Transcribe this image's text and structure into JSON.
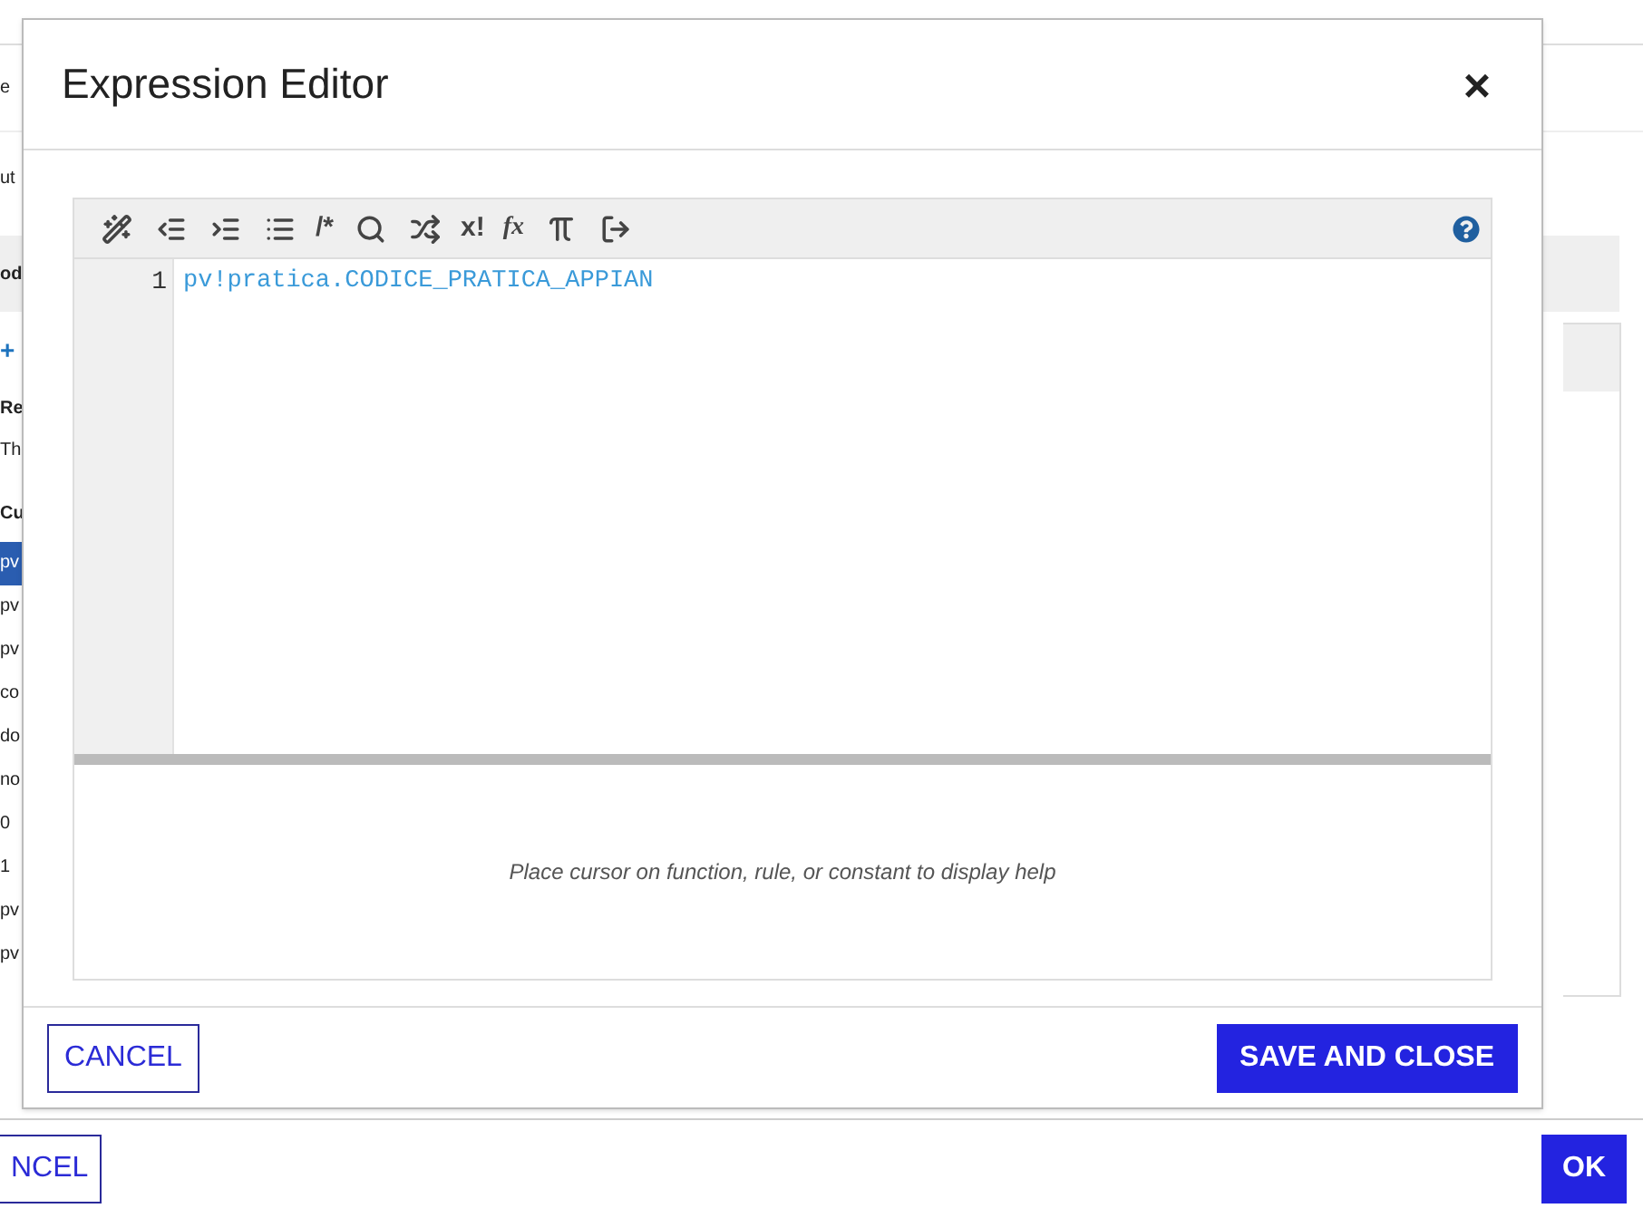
{
  "background": {
    "line_1": "e",
    "line_2": "ut",
    "panel_header": "od",
    "add": "+",
    "section_1": {
      "title": "Re",
      "text": "Th"
    },
    "section_2": {
      "title": "Cu",
      "items": [
        {
          "label": "pv",
          "selected": true
        },
        {
          "label": "pv",
          "selected": false
        },
        {
          "label": "pv",
          "selected": false
        },
        {
          "label": "co",
          "selected": false
        },
        {
          "label": "do",
          "selected": false
        },
        {
          "label": "no",
          "selected": false
        },
        {
          "label": "0",
          "selected": false
        },
        {
          "label": "1",
          "selected": false
        },
        {
          "label": "pv",
          "selected": false
        },
        {
          "label": "pv",
          "selected": false
        }
      ]
    },
    "buttons": {
      "cancel": "NCEL",
      "ok": "OK"
    }
  },
  "dialog": {
    "title": "Expression Editor",
    "close": "×",
    "toolbar": [
      {
        "kind": "icon"
      },
      {
        "kind": "icon"
      },
      {
        "kind": "icon"
      },
      {
        "kind": "icon"
      },
      {
        "kind": "text",
        "label": "/*"
      },
      {
        "kind": "icon"
      },
      {
        "kind": "icon"
      },
      {
        "kind": "text",
        "label": "x!"
      },
      {
        "kind": "italic",
        "label": "fx"
      },
      {
        "kind": "icon"
      },
      {
        "kind": "icon"
      }
    ],
    "code_lines": [
      {
        "number": "1",
        "text": "pv!pratica.CODICE_PRATICA_APPIAN"
      }
    ],
    "help_text": "Place cursor on function, rule, or constant to display help",
    "buttons": {
      "cancel": "CANCEL",
      "save": "SAVE AND CLOSE"
    }
  }
}
